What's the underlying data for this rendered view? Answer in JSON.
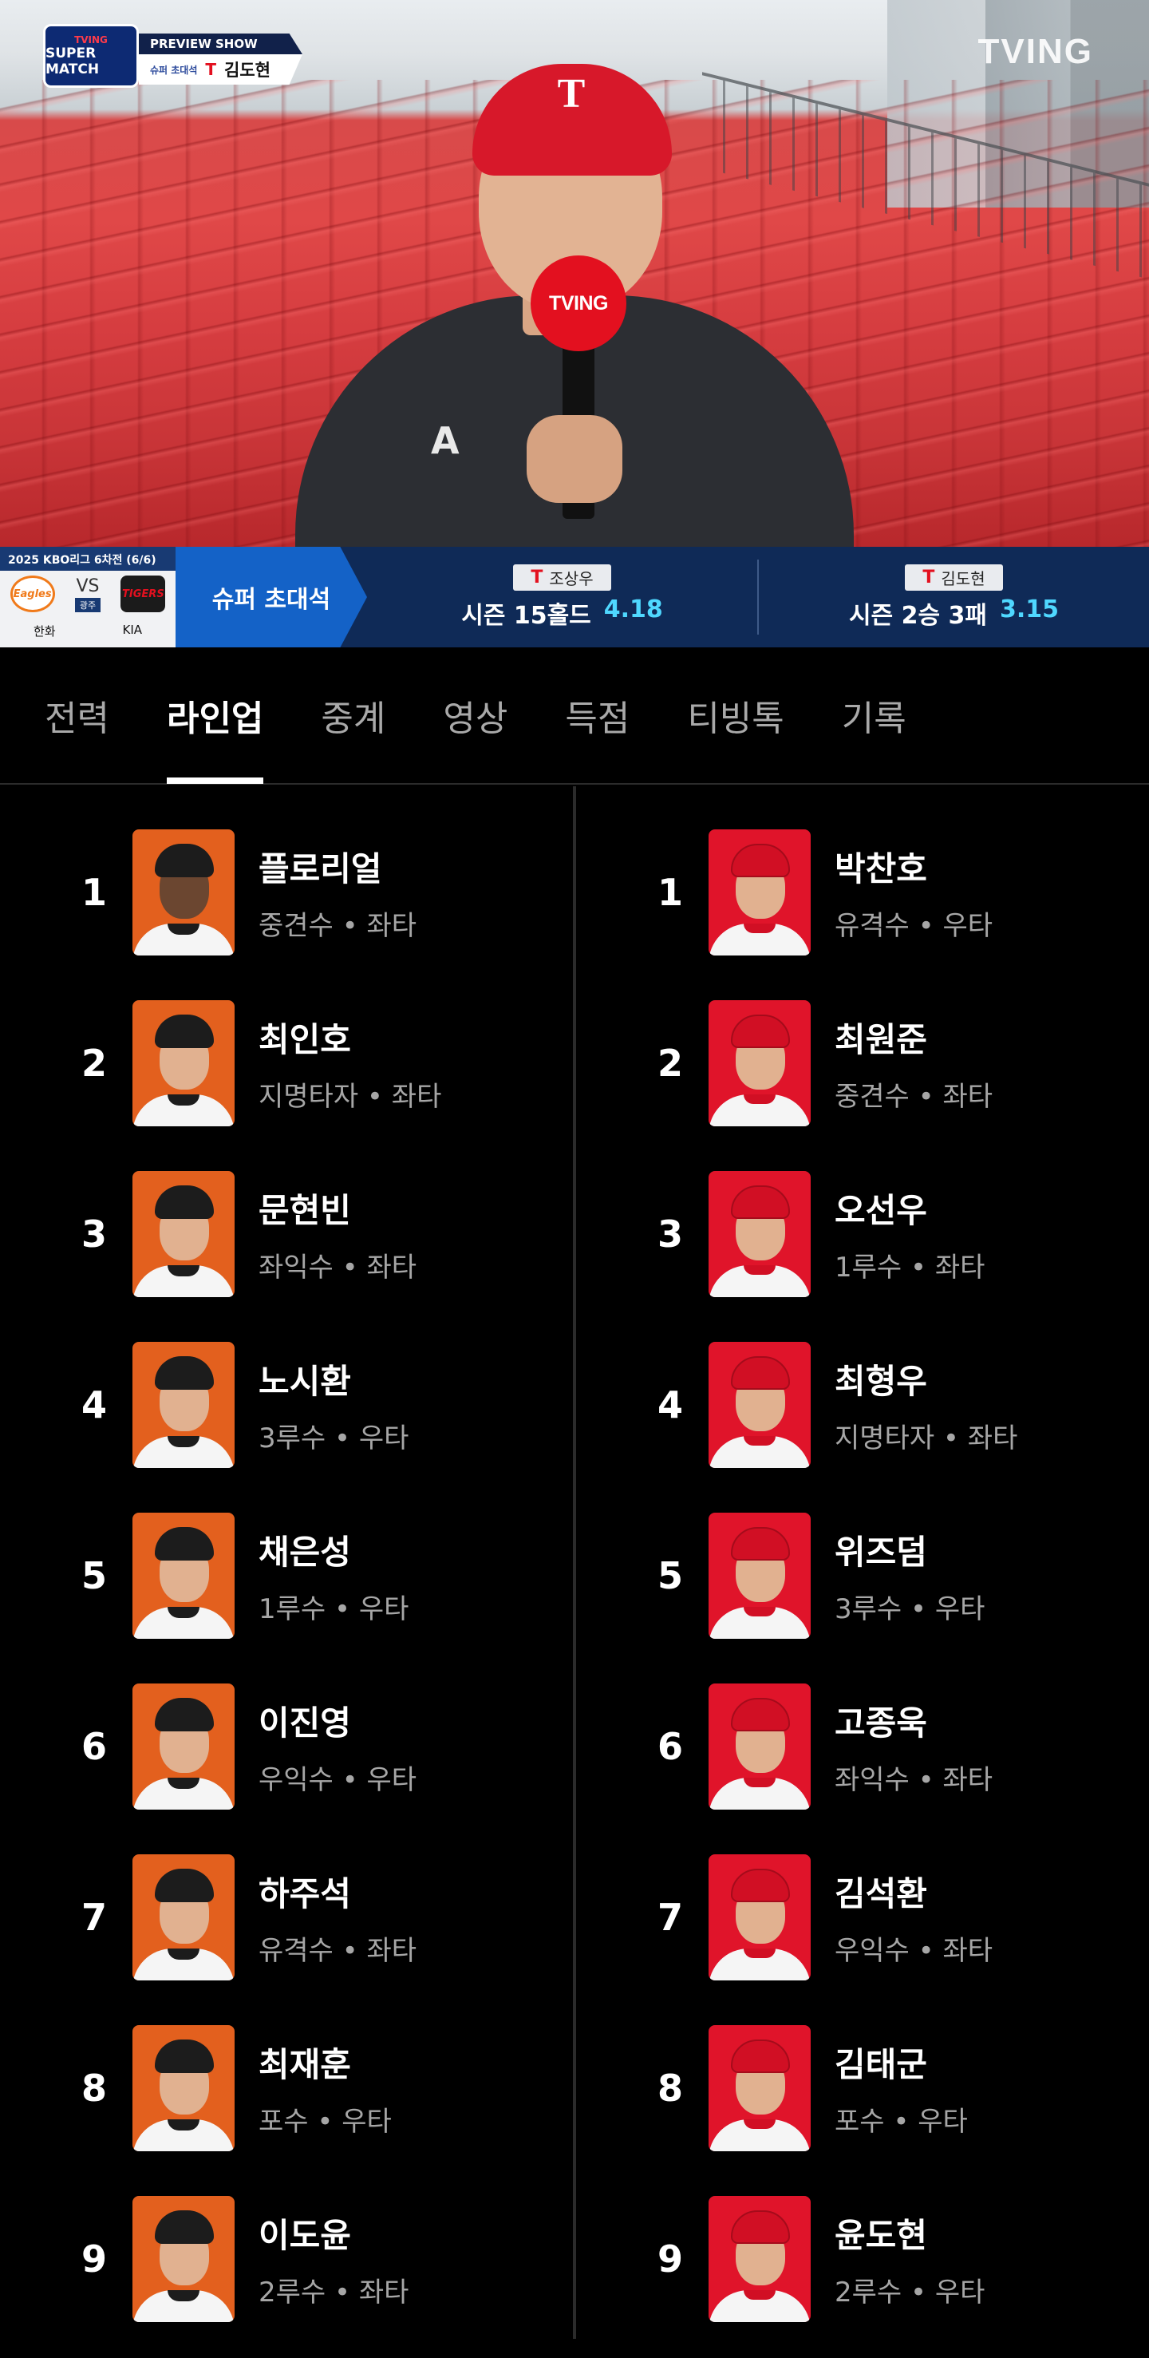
{
  "broadcast": {
    "show_logo_line1": "TVING",
    "show_logo_line2": "SUPER MATCH",
    "show_title": "PREVIEW SHOW",
    "show_sub": "슈퍼 초대석",
    "show_guest": "김도현",
    "watermark": "TVING",
    "mic_label": "TVING",
    "cap_logo": "T",
    "shirt_logo": "A"
  },
  "scorebar": {
    "league": "2025 KBO리그 6차전 (6/6)",
    "vs": "VS",
    "stadium": "광주",
    "home_logo": "Eagles",
    "away_logo": "TIGERS",
    "home_name": "한화",
    "away_name": "KIA",
    "segment": "슈퍼 초대석",
    "players": [
      {
        "name": "조상우",
        "stat": "시즌 15홀드",
        "era": "4.18"
      },
      {
        "name": "김도현",
        "stat": "시즌 2승 3패",
        "era": "3.15"
      }
    ],
    "icon": "T"
  },
  "tabs": [
    "전력",
    "라인업",
    "중계",
    "영상",
    "득점",
    "티빙톡",
    "기록"
  ],
  "active_tab": "라인업",
  "lineup": {
    "home": [
      {
        "order": "1",
        "name": "플로리얼",
        "pos": "중견수 • 좌타"
      },
      {
        "order": "2",
        "name": "최인호",
        "pos": "지명타자 • 좌타"
      },
      {
        "order": "3",
        "name": "문현빈",
        "pos": "좌익수 • 좌타"
      },
      {
        "order": "4",
        "name": "노시환",
        "pos": "3루수 • 우타"
      },
      {
        "order": "5",
        "name": "채은성",
        "pos": "1루수 • 우타"
      },
      {
        "order": "6",
        "name": "이진영",
        "pos": "우익수 • 우타"
      },
      {
        "order": "7",
        "name": "하주석",
        "pos": "유격수 • 좌타"
      },
      {
        "order": "8",
        "name": "최재훈",
        "pos": "포수 • 우타"
      },
      {
        "order": "9",
        "name": "이도윤",
        "pos": "2루수 • 좌타"
      }
    ],
    "away": [
      {
        "order": "1",
        "name": "박찬호",
        "pos": "유격수 • 우타"
      },
      {
        "order": "2",
        "name": "최원준",
        "pos": "중견수 • 좌타"
      },
      {
        "order": "3",
        "name": "오선우",
        "pos": "1루수 • 좌타"
      },
      {
        "order": "4",
        "name": "최형우",
        "pos": "지명타자 • 좌타"
      },
      {
        "order": "5",
        "name": "위즈덤",
        "pos": "3루수 • 우타"
      },
      {
        "order": "6",
        "name": "고종욱",
        "pos": "좌익수 • 좌타"
      },
      {
        "order": "7",
        "name": "김석환",
        "pos": "우익수 • 좌타"
      },
      {
        "order": "8",
        "name": "김태군",
        "pos": "포수 • 우타"
      },
      {
        "order": "9",
        "name": "윤도현",
        "pos": "2루수 • 우타"
      }
    ]
  },
  "colors": {
    "hanwha_orange": "#e3601e",
    "kia_red": "#e0142a",
    "era_accent": "#4fd8ff",
    "segment_blue": "#1462c7"
  }
}
